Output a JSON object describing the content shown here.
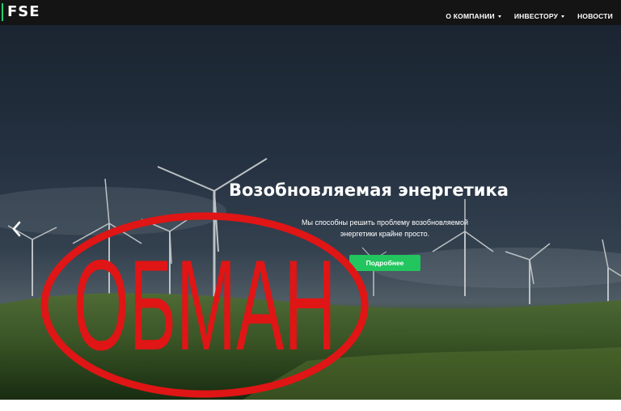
{
  "brand": {
    "logo_text": "FSE",
    "accent": "#1fd16a"
  },
  "nav": {
    "items": [
      "О КОМПАНИИ",
      "ИНВЕСТОРУ",
      "НОВОСТИ"
    ]
  },
  "hero": {
    "title": "Возобновляемая энергетика",
    "subtitle": "Мы способны решить проблему возобновляемой энергетики крайне просто.",
    "button_label": "Подробнее",
    "button_color": "#22c55e",
    "prev_icon": "chevron-left-icon"
  },
  "stamp": {
    "text": "ОБМАН",
    "color": "#e01515"
  }
}
